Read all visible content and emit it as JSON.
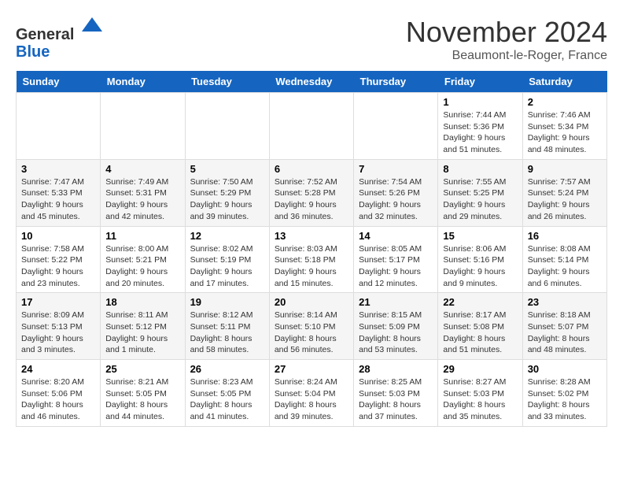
{
  "logo": {
    "general": "General",
    "blue": "Blue"
  },
  "header": {
    "month": "November 2024",
    "location": "Beaumont-le-Roger, France"
  },
  "columns": [
    "Sunday",
    "Monday",
    "Tuesday",
    "Wednesday",
    "Thursday",
    "Friday",
    "Saturday"
  ],
  "weeks": [
    [
      {
        "day": "",
        "info": ""
      },
      {
        "day": "",
        "info": ""
      },
      {
        "day": "",
        "info": ""
      },
      {
        "day": "",
        "info": ""
      },
      {
        "day": "",
        "info": ""
      },
      {
        "day": "1",
        "info": "Sunrise: 7:44 AM\nSunset: 5:36 PM\nDaylight: 9 hours\nand 51 minutes."
      },
      {
        "day": "2",
        "info": "Sunrise: 7:46 AM\nSunset: 5:34 PM\nDaylight: 9 hours\nand 48 minutes."
      }
    ],
    [
      {
        "day": "3",
        "info": "Sunrise: 7:47 AM\nSunset: 5:33 PM\nDaylight: 9 hours\nand 45 minutes."
      },
      {
        "day": "4",
        "info": "Sunrise: 7:49 AM\nSunset: 5:31 PM\nDaylight: 9 hours\nand 42 minutes."
      },
      {
        "day": "5",
        "info": "Sunrise: 7:50 AM\nSunset: 5:29 PM\nDaylight: 9 hours\nand 39 minutes."
      },
      {
        "day": "6",
        "info": "Sunrise: 7:52 AM\nSunset: 5:28 PM\nDaylight: 9 hours\nand 36 minutes."
      },
      {
        "day": "7",
        "info": "Sunrise: 7:54 AM\nSunset: 5:26 PM\nDaylight: 9 hours\nand 32 minutes."
      },
      {
        "day": "8",
        "info": "Sunrise: 7:55 AM\nSunset: 5:25 PM\nDaylight: 9 hours\nand 29 minutes."
      },
      {
        "day": "9",
        "info": "Sunrise: 7:57 AM\nSunset: 5:24 PM\nDaylight: 9 hours\nand 26 minutes."
      }
    ],
    [
      {
        "day": "10",
        "info": "Sunrise: 7:58 AM\nSunset: 5:22 PM\nDaylight: 9 hours\nand 23 minutes."
      },
      {
        "day": "11",
        "info": "Sunrise: 8:00 AM\nSunset: 5:21 PM\nDaylight: 9 hours\nand 20 minutes."
      },
      {
        "day": "12",
        "info": "Sunrise: 8:02 AM\nSunset: 5:19 PM\nDaylight: 9 hours\nand 17 minutes."
      },
      {
        "day": "13",
        "info": "Sunrise: 8:03 AM\nSunset: 5:18 PM\nDaylight: 9 hours\nand 15 minutes."
      },
      {
        "day": "14",
        "info": "Sunrise: 8:05 AM\nSunset: 5:17 PM\nDaylight: 9 hours\nand 12 minutes."
      },
      {
        "day": "15",
        "info": "Sunrise: 8:06 AM\nSunset: 5:16 PM\nDaylight: 9 hours\nand 9 minutes."
      },
      {
        "day": "16",
        "info": "Sunrise: 8:08 AM\nSunset: 5:14 PM\nDaylight: 9 hours\nand 6 minutes."
      }
    ],
    [
      {
        "day": "17",
        "info": "Sunrise: 8:09 AM\nSunset: 5:13 PM\nDaylight: 9 hours\nand 3 minutes."
      },
      {
        "day": "18",
        "info": "Sunrise: 8:11 AM\nSunset: 5:12 PM\nDaylight: 9 hours\nand 1 minute."
      },
      {
        "day": "19",
        "info": "Sunrise: 8:12 AM\nSunset: 5:11 PM\nDaylight: 8 hours\nand 58 minutes."
      },
      {
        "day": "20",
        "info": "Sunrise: 8:14 AM\nSunset: 5:10 PM\nDaylight: 8 hours\nand 56 minutes."
      },
      {
        "day": "21",
        "info": "Sunrise: 8:15 AM\nSunset: 5:09 PM\nDaylight: 8 hours\nand 53 minutes."
      },
      {
        "day": "22",
        "info": "Sunrise: 8:17 AM\nSunset: 5:08 PM\nDaylight: 8 hours\nand 51 minutes."
      },
      {
        "day": "23",
        "info": "Sunrise: 8:18 AM\nSunset: 5:07 PM\nDaylight: 8 hours\nand 48 minutes."
      }
    ],
    [
      {
        "day": "24",
        "info": "Sunrise: 8:20 AM\nSunset: 5:06 PM\nDaylight: 8 hours\nand 46 minutes."
      },
      {
        "day": "25",
        "info": "Sunrise: 8:21 AM\nSunset: 5:05 PM\nDaylight: 8 hours\nand 44 minutes."
      },
      {
        "day": "26",
        "info": "Sunrise: 8:23 AM\nSunset: 5:05 PM\nDaylight: 8 hours\nand 41 minutes."
      },
      {
        "day": "27",
        "info": "Sunrise: 8:24 AM\nSunset: 5:04 PM\nDaylight: 8 hours\nand 39 minutes."
      },
      {
        "day": "28",
        "info": "Sunrise: 8:25 AM\nSunset: 5:03 PM\nDaylight: 8 hours\nand 37 minutes."
      },
      {
        "day": "29",
        "info": "Sunrise: 8:27 AM\nSunset: 5:03 PM\nDaylight: 8 hours\nand 35 minutes."
      },
      {
        "day": "30",
        "info": "Sunrise: 8:28 AM\nSunset: 5:02 PM\nDaylight: 8 hours\nand 33 minutes."
      }
    ]
  ]
}
